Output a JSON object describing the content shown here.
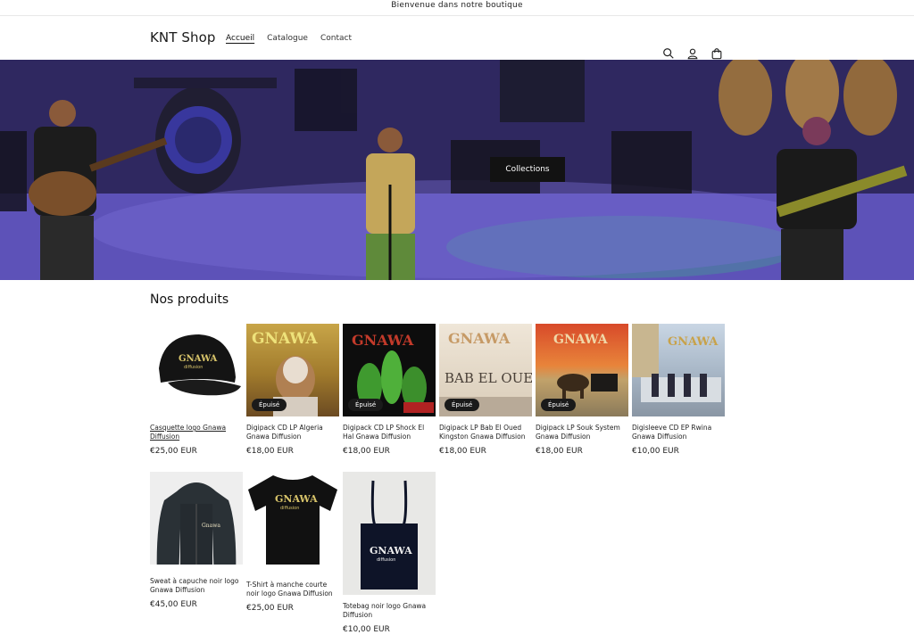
{
  "announcement": "Bienvenue dans notre boutique",
  "header": {
    "logo": "KNT Shop",
    "nav": [
      "Accueil",
      "Catalogue",
      "Contact"
    ]
  },
  "hero": {
    "button_label": "Collections"
  },
  "section_title": "Nos produits",
  "products": [
    {
      "title": "Casquette logo Gnawa Diffusion",
      "price": "€25,00 EUR",
      "badge": ""
    },
    {
      "title": "Digipack CD LP Algeria Gnawa Diffusion",
      "price": "€18,00 EUR",
      "badge": "Épuisé"
    },
    {
      "title": "Digipack CD LP Shock El Hal Gnawa Diffusion",
      "price": "€18,00 EUR",
      "badge": "Épuisé"
    },
    {
      "title": "Digipack LP Bab El Oued Kingston Gnawa Diffusion",
      "price": "€18,00 EUR",
      "badge": "Épuisé"
    },
    {
      "title": "Digipack LP Souk System Gnawa Diffusion",
      "price": "€18,00 EUR",
      "badge": "Épuisé"
    },
    {
      "title": "Digisleeve CD EP Rwina Gnawa Diffusion",
      "price": "€10,00 EUR",
      "badge": ""
    },
    {
      "title": "Sweat à capuche noir logo Gnawa Diffusion",
      "price": "€45,00 EUR",
      "badge": ""
    },
    {
      "title": "T-Shirt à manche courte noir logo Gnawa Diffusion",
      "price": "€25,00 EUR",
      "badge": ""
    },
    {
      "title": "Totebag noir logo Gnawa Diffusion",
      "price": "€10,00 EUR",
      "badge": ""
    }
  ]
}
